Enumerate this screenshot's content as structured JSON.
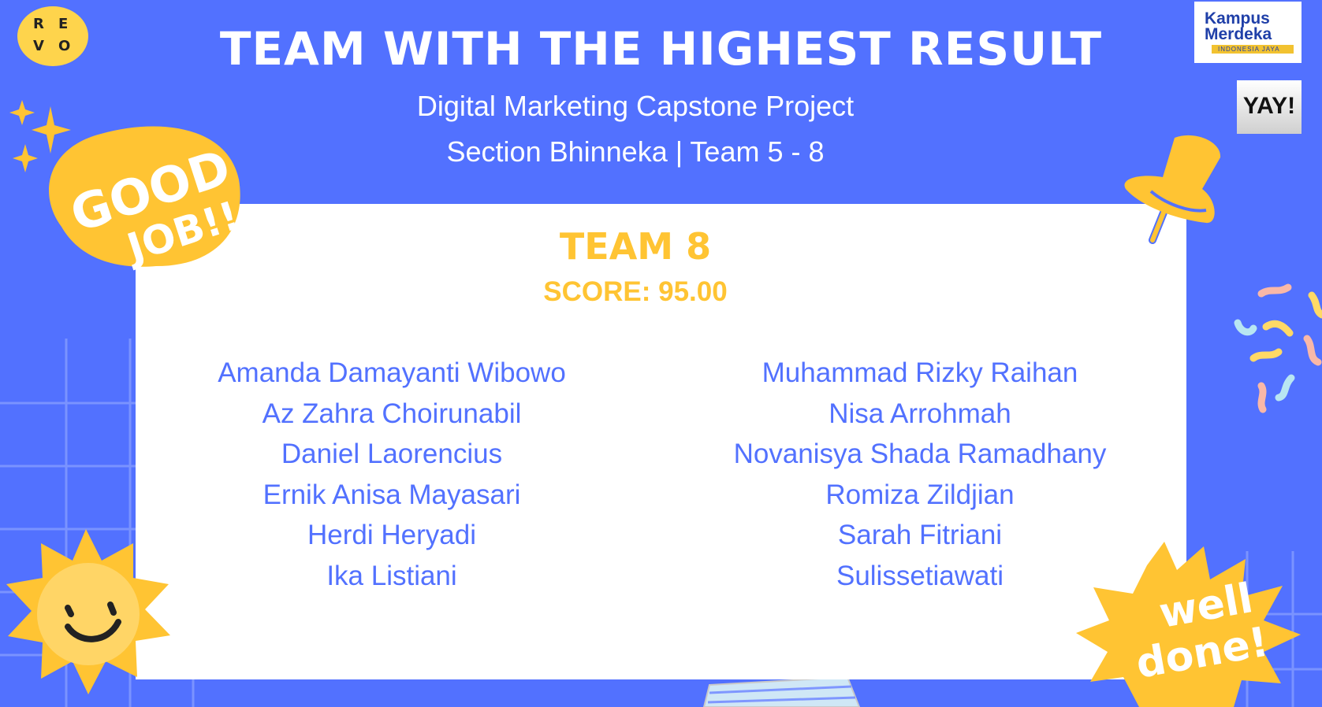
{
  "header": {
    "title": "TEAM WITH THE HIGHEST RESULT",
    "subtitle_line1": "Digital Marketing Capstone Project",
    "subtitle_line2": "Section Bhinneka | Team 5 - 8"
  },
  "winner": {
    "team": "TEAM 8",
    "score": "SCORE: 95.00",
    "members_left": [
      "Amanda Damayanti Wibowo",
      "Az Zahra Choirunabil",
      "Daniel Laorencius",
      "Ernik Anisa Mayasari",
      "Herdi Heryadi",
      "Ika Listiani"
    ],
    "members_right": [
      "Muhammad Rizky Raihan",
      "Nisa Arrohmah",
      "Novanisya Shada Ramadhany",
      "Romiza Zildjian",
      "Sarah Fitriani",
      "Sulissetiawati"
    ]
  },
  "logos": {
    "revo": [
      "R",
      "E",
      "V",
      "O"
    ],
    "kampus_merdeka": {
      "line1": "Kampus",
      "line2": "Merdeka",
      "tagline": "INDONESIA JAYA"
    }
  },
  "stickers": {
    "yay": "YAY!",
    "good_job": [
      "GOOD",
      "JOB!!"
    ],
    "well_done": [
      "well",
      "done!"
    ]
  },
  "colors": {
    "background": "#5271ff",
    "card": "#ffffff",
    "accent_yellow": "#ffc433",
    "member_text": "#5271ff"
  }
}
